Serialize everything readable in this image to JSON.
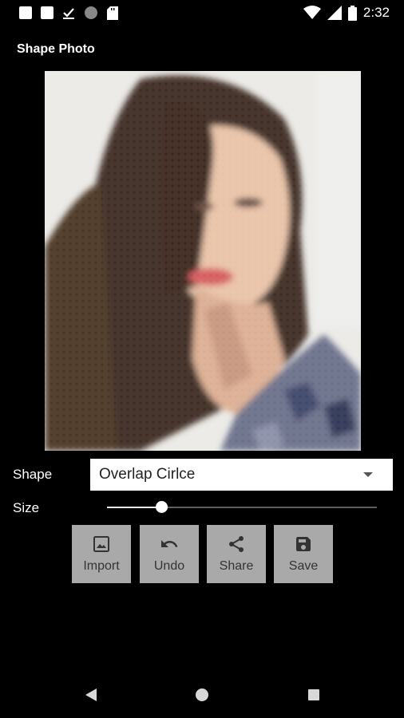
{
  "status_bar": {
    "time": "2:32"
  },
  "app": {
    "title": "Shape Photo"
  },
  "controls": {
    "shape_label": "Shape",
    "shape_value": "Overlap Cirlce",
    "size_label": "Size",
    "size_fraction": 0.2
  },
  "buttons": {
    "import": "Import",
    "undo": "Undo",
    "share": "Share",
    "save": "Save"
  },
  "icons": [
    "notification-icon",
    "notification-icon",
    "check-icon",
    "circle-icon",
    "sd-card-icon",
    "wifi-icon",
    "signal-icon",
    "battery-icon",
    "image-icon",
    "undo-icon",
    "share-icon",
    "save-icon",
    "back-icon",
    "home-icon",
    "recents-icon"
  ]
}
